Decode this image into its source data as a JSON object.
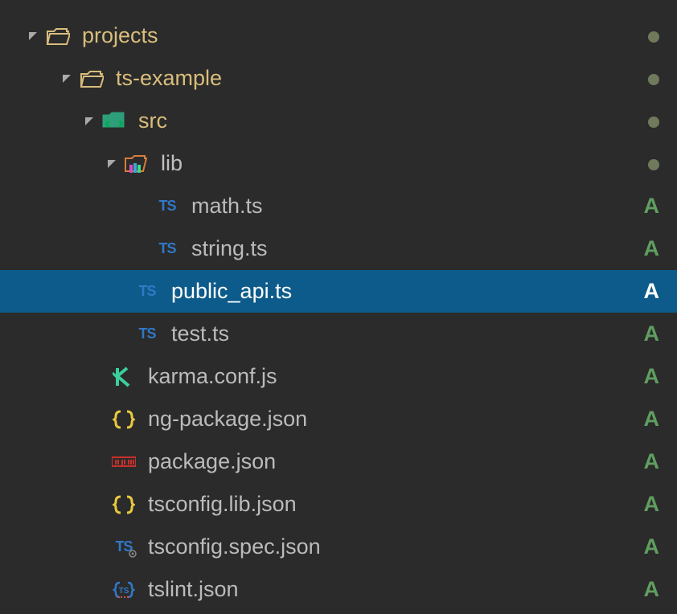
{
  "tree": {
    "projects": {
      "label": "projects",
      "status": "dot"
    },
    "ts_example": {
      "label": "ts-example",
      "status": "dot"
    },
    "src": {
      "label": "src",
      "status": "dot"
    },
    "lib": {
      "label": "lib",
      "status": "dot"
    },
    "math": {
      "label": "math.ts",
      "status": "A"
    },
    "string": {
      "label": "string.ts",
      "status": "A"
    },
    "public_api": {
      "label": "public_api.ts",
      "status": "A"
    },
    "test": {
      "label": "test.ts",
      "status": "A"
    },
    "karma": {
      "label": "karma.conf.js",
      "status": "A"
    },
    "ng_package": {
      "label": "ng-package.json",
      "status": "A"
    },
    "package": {
      "label": "package.json",
      "status": "A"
    },
    "tsconfig_lib": {
      "label": "tsconfig.lib.json",
      "status": "A"
    },
    "tsconfig_spec": {
      "label": "tsconfig.spec.json",
      "status": "A"
    },
    "tslint": {
      "label": "tslint.json",
      "status": "A"
    }
  }
}
